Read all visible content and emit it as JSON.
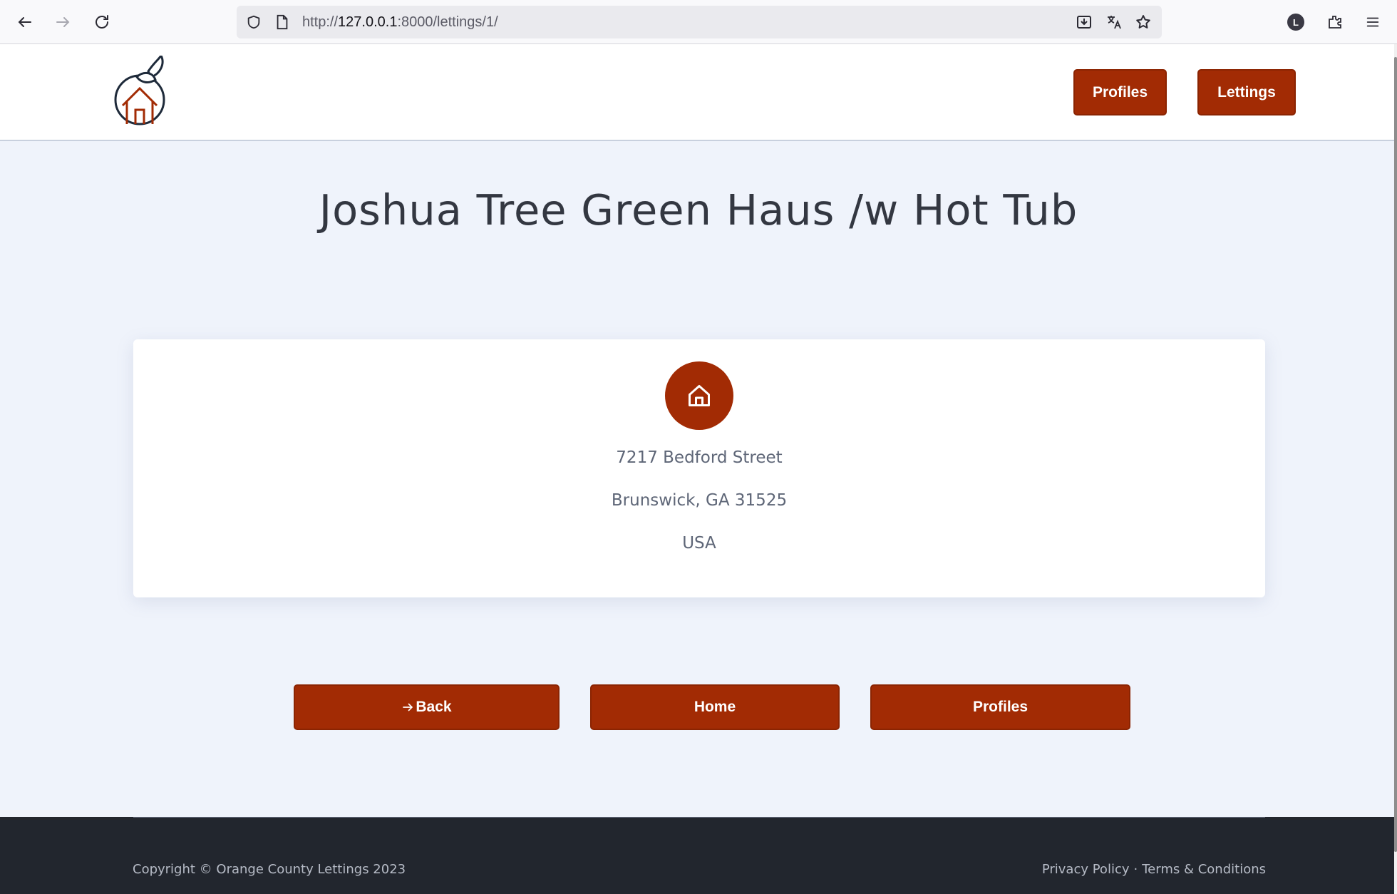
{
  "browser": {
    "url_scheme": "http://",
    "url_host": "127.0.0.1",
    "url_rest": ":8000/lettings/1/",
    "profile_initial": "L"
  },
  "header": {
    "nav": {
      "profiles_label": "Profiles",
      "lettings_label": "Lettings"
    }
  },
  "main": {
    "title": "Joshua Tree Green Haus /w Hot Tub",
    "address": {
      "street": "7217 Bedford Street",
      "city_line": "Brunswick, GA 31525",
      "country": "USA"
    },
    "actions": {
      "back_label": "Back",
      "home_label": "Home",
      "profiles_label": "Profiles"
    }
  },
  "footer": {
    "copyright": "Copyright © Orange County Lettings 2023",
    "privacy_label": "Privacy Policy",
    "separator": "·",
    "terms_label": "Terms & Conditions"
  },
  "colors": {
    "brand": "#a22b04",
    "page_bg": "#eff3fb",
    "footer_bg": "#22262e",
    "title_text": "#333741"
  }
}
